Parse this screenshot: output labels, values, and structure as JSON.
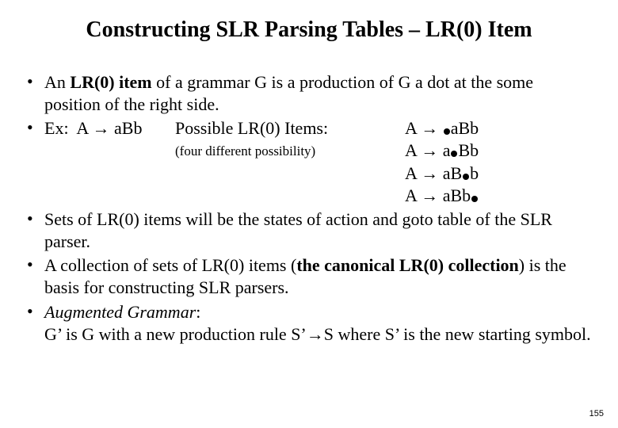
{
  "title": "Constructing SLR Parsing Tables – LR(0) Item",
  "b1": {
    "pre": "An ",
    "term": "LR(0) item",
    "post": " of a grammar G is a production of G a dot at the some position of the right side."
  },
  "b2": {
    "label": "Ex:",
    "prod_lhs": "A ",
    "prod_rhs": " aBb",
    "poss": "Possible LR(0) Items:",
    "note": "(four different possibility)",
    "items": {
      "i1": {
        "lhs": "A ",
        "s1": "",
        "s2": "aBb"
      },
      "i2": {
        "lhs": "A ",
        "s1": "a",
        "s2": "Bb"
      },
      "i3": {
        "lhs": "A ",
        "s1": "aB",
        "s2": "b"
      },
      "i4": {
        "lhs": "A ",
        "s1": "aBb",
        "s2": ""
      }
    }
  },
  "b3": "Sets of LR(0) items will be the states of action and goto table of the SLR parser.",
  "b4": {
    "pre": "A collection of sets of LR(0) items (",
    "term": "the canonical LR(0) collection",
    "post": ") is the basis  for constructing SLR parsers."
  },
  "b5": {
    "head": "Augmented Grammar",
    "colon": ":",
    "body_pre": "G’ is G with a new production rule S’",
    "body_post": "S where S’ is the new starting symbol."
  },
  "arrow": "→",
  "page": "155"
}
